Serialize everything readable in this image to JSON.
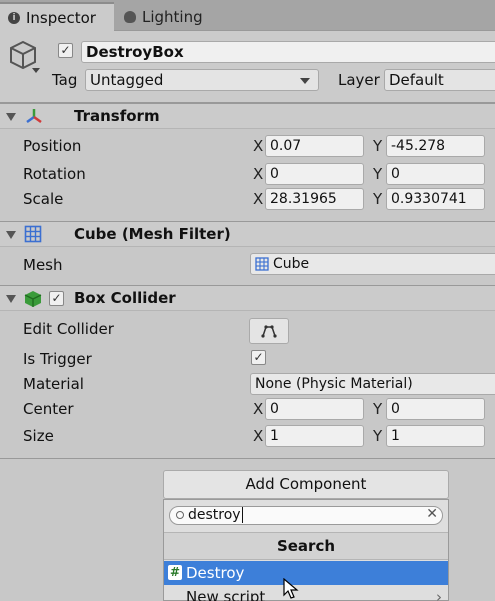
{
  "tabs": [
    {
      "label": "Inspector",
      "icon": "info-icon",
      "active": true
    },
    {
      "label": "Lighting",
      "icon": "lightbulb-icon",
      "active": false
    }
  ],
  "object": {
    "name": "DestroyBox",
    "active": true,
    "tag_label": "Tag",
    "tag_value": "Untagged",
    "layer_label": "Layer",
    "layer_value": "Default"
  },
  "transform": {
    "title": "Transform",
    "position_label": "Position",
    "rotation_label": "Rotation",
    "scale_label": "Scale",
    "position": {
      "x": "0.07",
      "y": "-45.278"
    },
    "rotation": {
      "x": "0",
      "y": "0"
    },
    "scale": {
      "x": "28.31965",
      "y": "0.9330741"
    }
  },
  "mesh_filter": {
    "title": "Cube (Mesh Filter)",
    "mesh_label": "Mesh",
    "mesh_value": "Cube"
  },
  "box_collider": {
    "title": "Box Collider",
    "enabled": true,
    "edit_collider_label": "Edit Collider",
    "is_trigger_label": "Is Trigger",
    "is_trigger": true,
    "material_label": "Material",
    "material_value": "None (Physic Material)",
    "center_label": "Center",
    "size_label": "Size",
    "center": {
      "x": "0",
      "y": "0"
    },
    "size": {
      "x": "1",
      "y": "1"
    }
  },
  "axes": {
    "x": "X",
    "y": "Y"
  },
  "add_component": {
    "button_label": "Add Component",
    "search_value": "destroy",
    "section_title": "Search",
    "items": [
      {
        "label": "Destroy",
        "selected": true
      },
      {
        "label": "New script",
        "selected": false
      }
    ]
  },
  "colors": {
    "selection": "#3d7fd9",
    "panel": "#c8c8c8"
  }
}
